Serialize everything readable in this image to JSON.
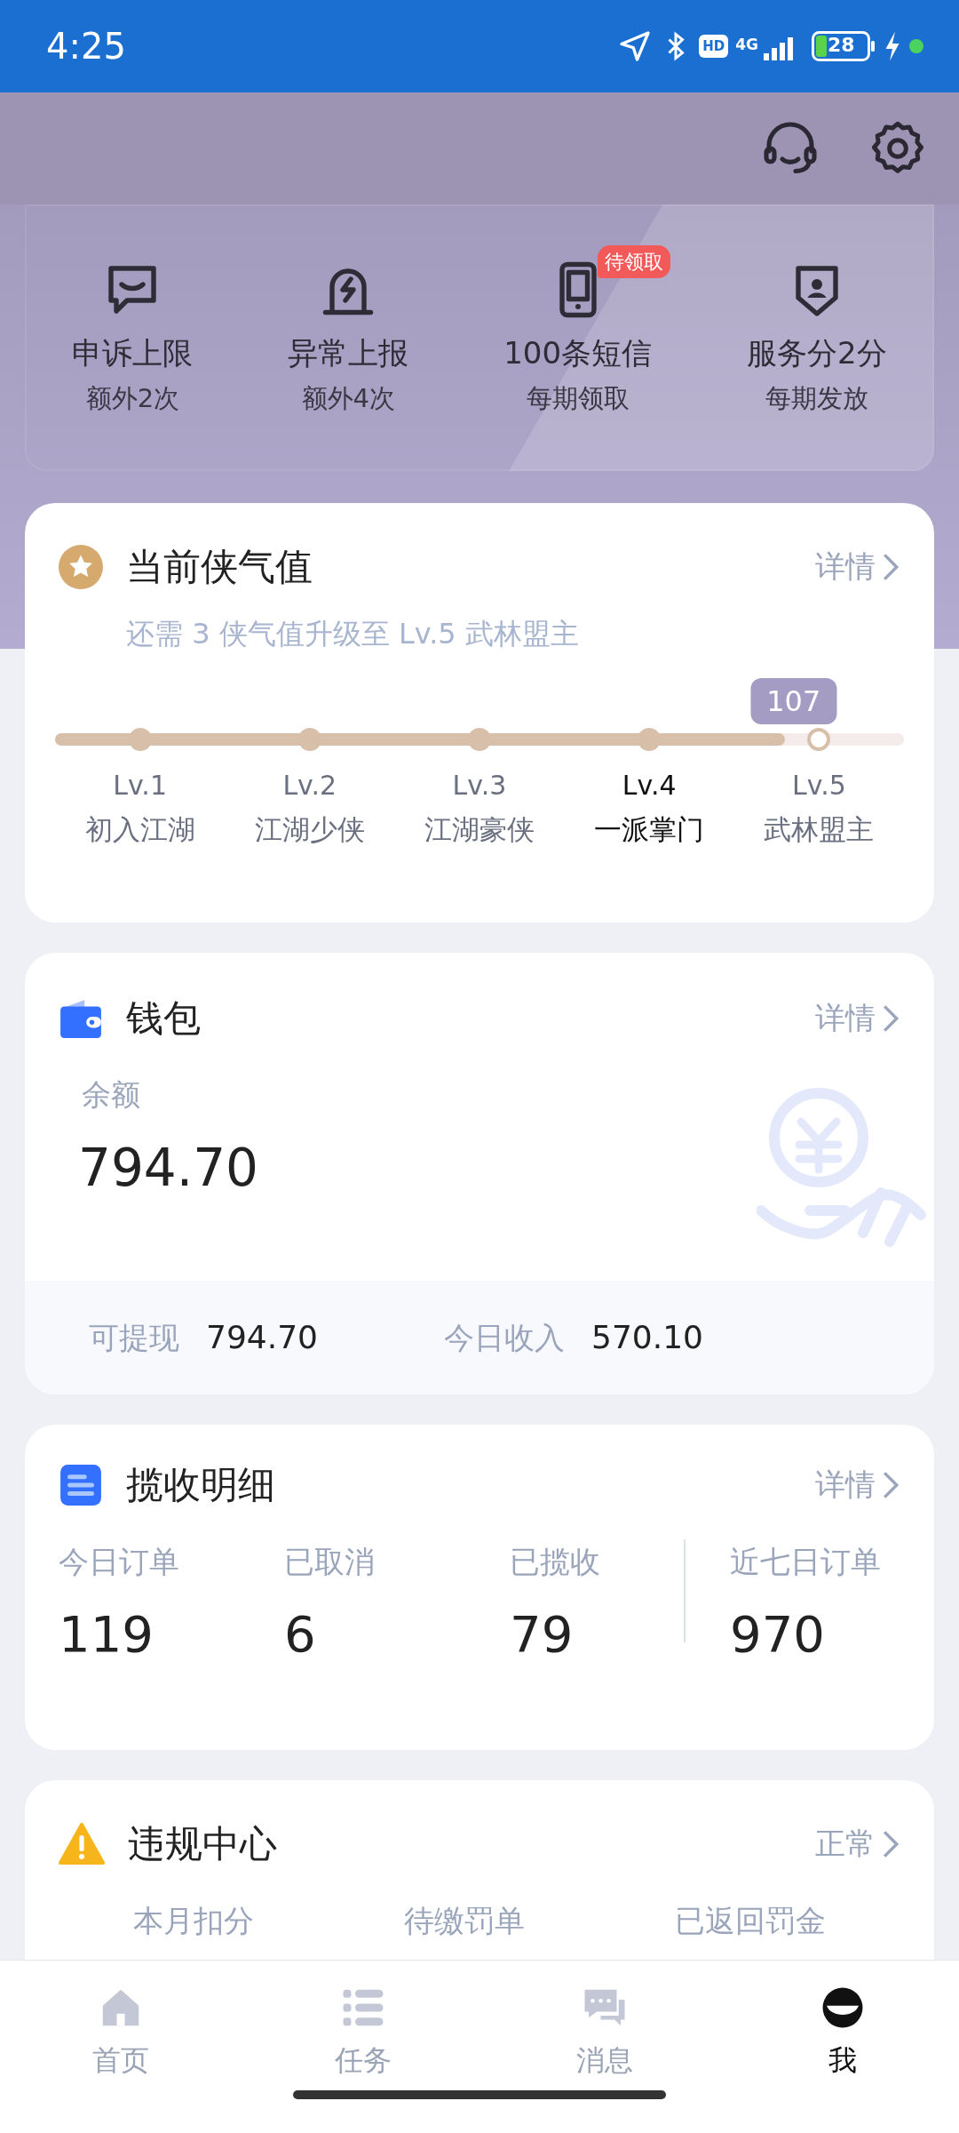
{
  "status_bar": {
    "time": "4:25",
    "hd": "HD",
    "network": "4G",
    "battery": "28"
  },
  "perks": [
    {
      "title": "申诉上限",
      "note": "额外2次"
    },
    {
      "title": "异常上报",
      "note": "额外4次"
    },
    {
      "title": "100条短信",
      "note": "每期领取",
      "badge": "待领取"
    },
    {
      "title": "服务分2分",
      "note": "每期发放"
    }
  ],
  "level_card": {
    "title": "当前侠气值",
    "link": "详情",
    "hint": "还需 3 侠气值升级至 Lv.5 武林盟主",
    "score": "107",
    "level": 0.86,
    "levels": [
      {
        "code": "Lv.1",
        "name": "初入江湖",
        "reached": true,
        "selected": false
      },
      {
        "code": "Lv.2",
        "name": "江湖少侠",
        "reached": true,
        "selected": false
      },
      {
        "code": "Lv.3",
        "name": "江湖豪侠",
        "reached": true,
        "selected": false
      },
      {
        "code": "Lv.4",
        "name": "一派掌门",
        "reached": true,
        "selected": true
      },
      {
        "code": "Lv.5",
        "name": "武林盟主",
        "reached": false,
        "selected": false
      }
    ]
  },
  "wallet": {
    "title": "钱包",
    "link": "详情",
    "balance_label": "余额",
    "balance": "794.70",
    "stats": [
      {
        "label": "可提现",
        "value": "794.70"
      },
      {
        "label": "今日收入",
        "value": "570.10"
      }
    ]
  },
  "pickup": {
    "title": "揽收明细",
    "link": "详情",
    "stats": [
      {
        "label": "今日订单",
        "value": "119"
      },
      {
        "label": "已取消",
        "value": "6"
      },
      {
        "label": "已揽收",
        "value": "79"
      },
      {
        "label": "近七日订单",
        "value": "970"
      }
    ]
  },
  "violations": {
    "title": "违规中心",
    "link": "正常",
    "columns": [
      "本月扣分",
      "待缴罚单",
      "已返回罚金"
    ]
  },
  "tabs": [
    {
      "label": "首页",
      "selected": false
    },
    {
      "label": "任务",
      "selected": false
    },
    {
      "label": "消息",
      "selected": false
    },
    {
      "label": "我",
      "selected": true
    }
  ]
}
